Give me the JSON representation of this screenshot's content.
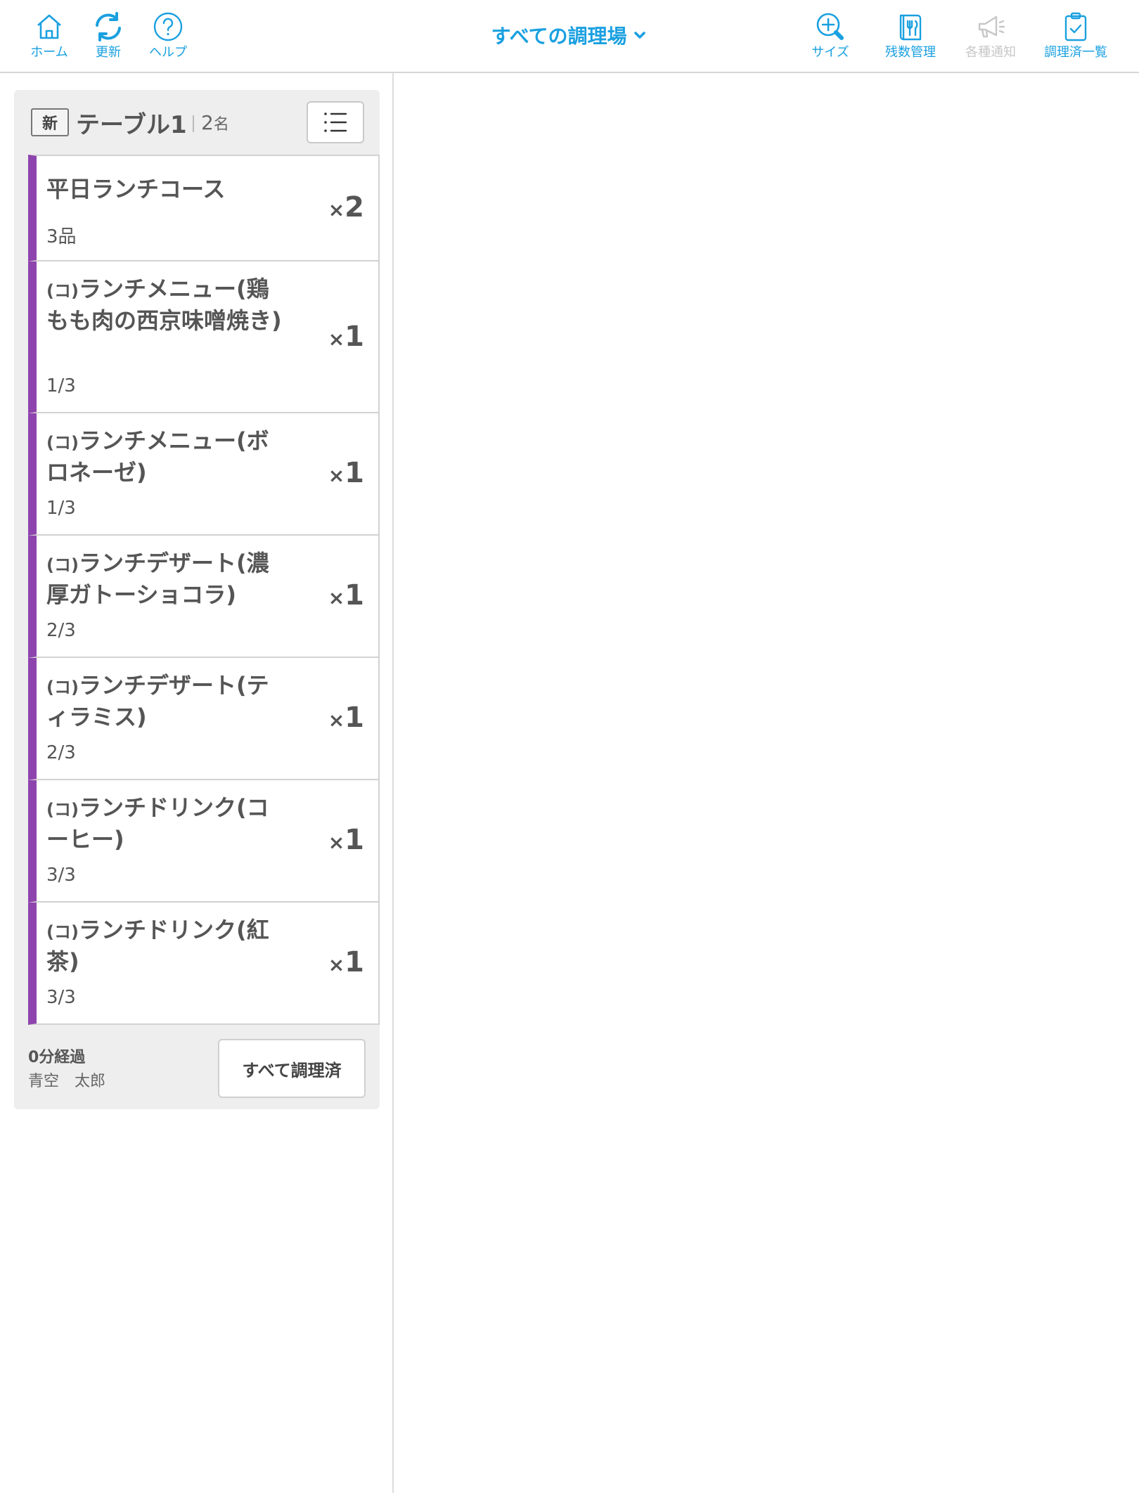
{
  "header": {
    "left_buttons": [
      {
        "label": "ホーム",
        "icon": "home-icon"
      },
      {
        "label": "更新",
        "icon": "refresh-icon"
      },
      {
        "label": "ヘルプ",
        "icon": "help-icon"
      }
    ],
    "station_selector": "すべての調理場",
    "right_buttons": [
      {
        "label": "サイズ",
        "icon": "zoom-in-icon",
        "enabled": true
      },
      {
        "label": "残数管理",
        "icon": "menu-book-icon",
        "enabled": true
      },
      {
        "label": "各種通知",
        "icon": "megaphone-icon",
        "enabled": false
      },
      {
        "label": "調理済一覧",
        "icon": "clipboard-check-icon",
        "enabled": true
      }
    ],
    "accent_color": "#1aa0e0",
    "disabled_color": "#c7c7c7"
  },
  "order": {
    "new_badge": "新",
    "table": "テーブル1",
    "guests_count": "2",
    "guests_unit": "名",
    "items": [
      {
        "prefix": "",
        "name": "平日ランチコース",
        "sub": "3品",
        "qty_mark": "×",
        "qty": "2"
      },
      {
        "prefix": "(コ)",
        "name": "ランチメニュー(鶏もも肉の西京味噌焼き)",
        "sub": "1/3",
        "qty_mark": "×",
        "qty": "1"
      },
      {
        "prefix": "(コ)",
        "name": "ランチメニュー(ボロネーゼ)",
        "sub": "1/3",
        "qty_mark": "×",
        "qty": "1"
      },
      {
        "prefix": "(コ)",
        "name": "ランチデザート(濃厚ガトーショコラ)",
        "sub": "2/3",
        "qty_mark": "×",
        "qty": "1"
      },
      {
        "prefix": "(コ)",
        "name": "ランチデザート(ティラミス)",
        "sub": "2/3",
        "qty_mark": "×",
        "qty": "1"
      },
      {
        "prefix": "(コ)",
        "name": "ランチドリンク(コーヒー)",
        "sub": "3/3",
        "qty_mark": "×",
        "qty": "1"
      },
      {
        "prefix": "(コ)",
        "name": "ランチドリンク(紅茶)",
        "sub": "3/3",
        "qty_mark": "×",
        "qty": "1"
      }
    ],
    "item_accent_color": "#8e44ad",
    "elapsed": "0分経過",
    "staff": "青空　太郎",
    "complete_all_label": "すべて調理済"
  }
}
